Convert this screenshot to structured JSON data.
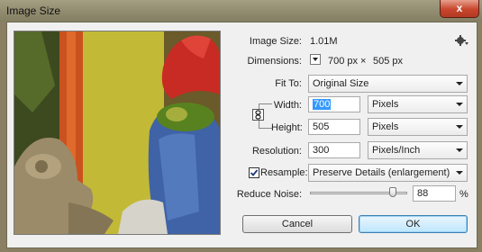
{
  "window": {
    "title": "Image Size",
    "close_glyph": "x"
  },
  "info": {
    "image_size_label": "Image Size:",
    "image_size_value": "1.01M",
    "dimensions_label": "Dimensions:",
    "dimensions_w": "700 px",
    "dimensions_x": "×",
    "dimensions_h": "505 px"
  },
  "fit_to": {
    "label": "Fit To:",
    "value": "Original Size"
  },
  "width": {
    "label": "Width:",
    "value": "700",
    "unit": "Pixels"
  },
  "height": {
    "label": "Height:",
    "value": "505",
    "unit": "Pixels"
  },
  "resolution": {
    "label": "Resolution:",
    "value": "300",
    "unit": "Pixels/Inch"
  },
  "resample": {
    "label": "Resample:",
    "checked": true,
    "value": "Preserve Details (enlargement)"
  },
  "reduce_noise": {
    "label": "Reduce Noise:",
    "value": "88",
    "unit": "%",
    "level_percent": 88
  },
  "buttons": {
    "cancel": "Cancel",
    "ok": "OK"
  },
  "icons": {
    "gear": "gear-icon",
    "link": "chain-link-icon",
    "dimensions_menu": "triangle-menu-icon",
    "close": "close-icon"
  }
}
